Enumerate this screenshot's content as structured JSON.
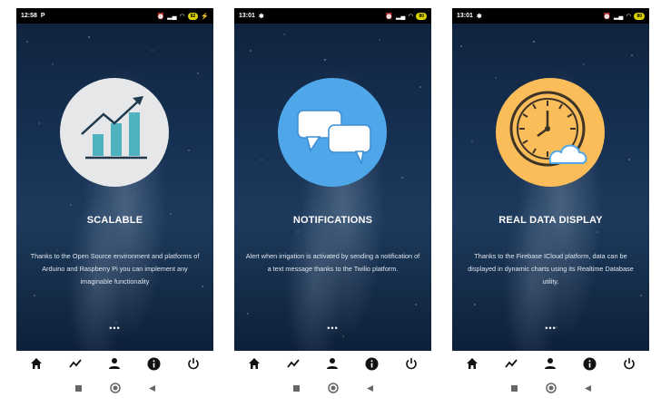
{
  "screens": [
    {
      "status": {
        "time": "12:58",
        "app_glyph": "P",
        "battery": "82"
      },
      "title": "SCALABLE",
      "description": "Thanks to the Open Source environment and platforms of Arduino and Raspberry Pi you can implement any imaginable functionality",
      "icon": "growth-chart-icon",
      "circle_color": "#e6e7e9"
    },
    {
      "status": {
        "time": "13:01",
        "app_glyph": "✱",
        "battery": "80"
      },
      "title": "NOTIFICATIONS",
      "description": "Alert when irrigation is activated by sending a notification of a text message thanks to the Twilio platform.",
      "icon": "chat-bubbles-icon",
      "circle_color": "#4fa7ea"
    },
    {
      "status": {
        "time": "13:01",
        "app_glyph": "✱",
        "battery": "80"
      },
      "title": "REAL DATA DISPLAY",
      "description": "Thanks to the Firebase ICloud platform, data can be displayed in dynamic charts using its Realtime Database utility.",
      "icon": "clock-cloud-icon",
      "circle_color": "#fbbd59"
    }
  ],
  "page_indicator": "•••",
  "bottom_nav": [
    "home-icon",
    "trending-icon",
    "person-icon",
    "info-icon",
    "power-icon"
  ],
  "system_nav": [
    "recents-icon",
    "home-circle-icon",
    "back-icon"
  ]
}
